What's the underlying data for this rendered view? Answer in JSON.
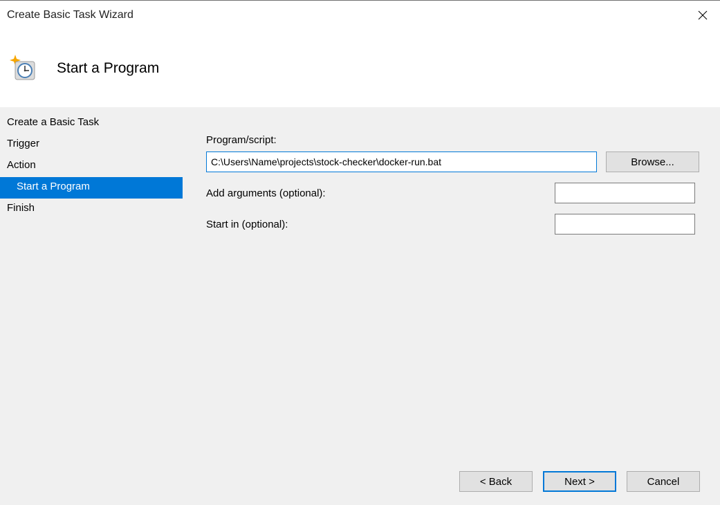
{
  "window": {
    "title": "Create Basic Task Wizard"
  },
  "header": {
    "title": "Start a Program"
  },
  "sidebar": {
    "items": [
      {
        "label": "Create a Basic Task",
        "indented": false,
        "selected": false
      },
      {
        "label": "Trigger",
        "indented": false,
        "selected": false
      },
      {
        "label": "Action",
        "indented": false,
        "selected": false
      },
      {
        "label": "Start a Program",
        "indented": true,
        "selected": true
      },
      {
        "label": "Finish",
        "indented": false,
        "selected": false
      }
    ]
  },
  "form": {
    "program_label": "Program/script:",
    "program_value": "C:\\Users\\Name\\projects\\stock-checker\\docker-run.bat",
    "browse_label": "Browse...",
    "arguments_label": "Add arguments (optional):",
    "arguments_value": "",
    "startin_label": "Start in (optional):",
    "startin_value": ""
  },
  "footer": {
    "back_label": "< Back",
    "next_label": "Next >",
    "cancel_label": "Cancel"
  }
}
